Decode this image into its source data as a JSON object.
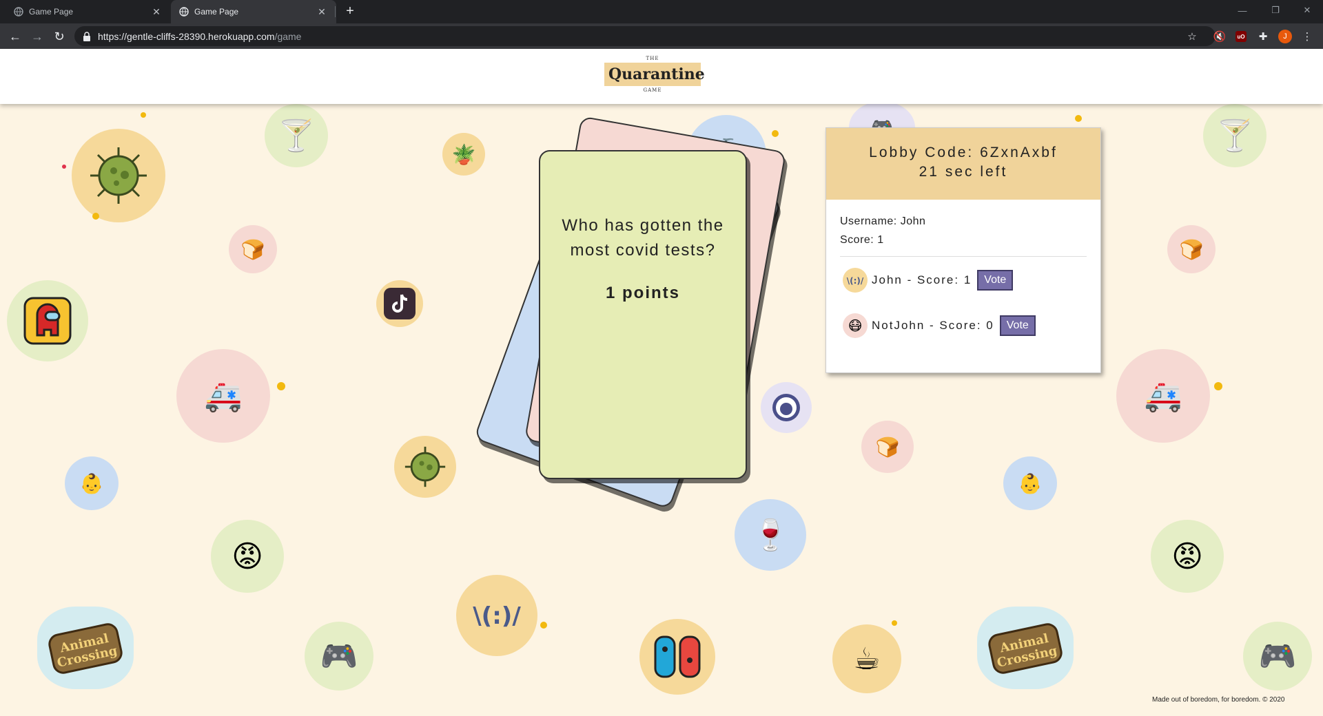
{
  "browser": {
    "tabs": [
      {
        "title": "Game Page",
        "active": false
      },
      {
        "title": "Game Page",
        "active": true
      }
    ],
    "url_host": "https://gentle-cliffs-28390.herokuapp.com",
    "url_path": "/game",
    "profile_initial": "J"
  },
  "site": {
    "logo_top": "THE",
    "logo_main": "Quarantine",
    "logo_bottom": "GAME"
  },
  "card": {
    "question": "Who has gotten the most covid tests?",
    "points": "1 points"
  },
  "lobby": {
    "code_line": "Lobby Code: 6ZxnAxbf",
    "timer_line": "21 sec left",
    "username_line": "Username: John",
    "score_line": "Score: 1",
    "players": [
      {
        "label": "John - Score: 1",
        "vote": "Vote"
      },
      {
        "label": "NotJohn - Score: 0",
        "vote": "Vote"
      }
    ]
  },
  "footer": "Made out of boredom, for boredom. © 2020",
  "colors": {
    "background": "#fdf4e3",
    "card_main": "#e6edb5",
    "card_pink": "#f6d9d3",
    "card_blue": "#c9dcf3",
    "lobby_header": "#f0d39a",
    "vote_button": "#766ea8"
  },
  "decorations": [
    "virus-icon",
    "martini-icon",
    "plant-icon",
    "hand-sanitizer-icon",
    "controller-icon",
    "toast-icon",
    "tiktok-icon",
    "among-us-icon",
    "ambulance-icon",
    "github-icon",
    "baby-icon",
    "rage-face-icon",
    "wine-icon",
    "shrug-emoticon-icon",
    "switch-icon",
    "coffee-icon",
    "animal-crossing-icon"
  ]
}
